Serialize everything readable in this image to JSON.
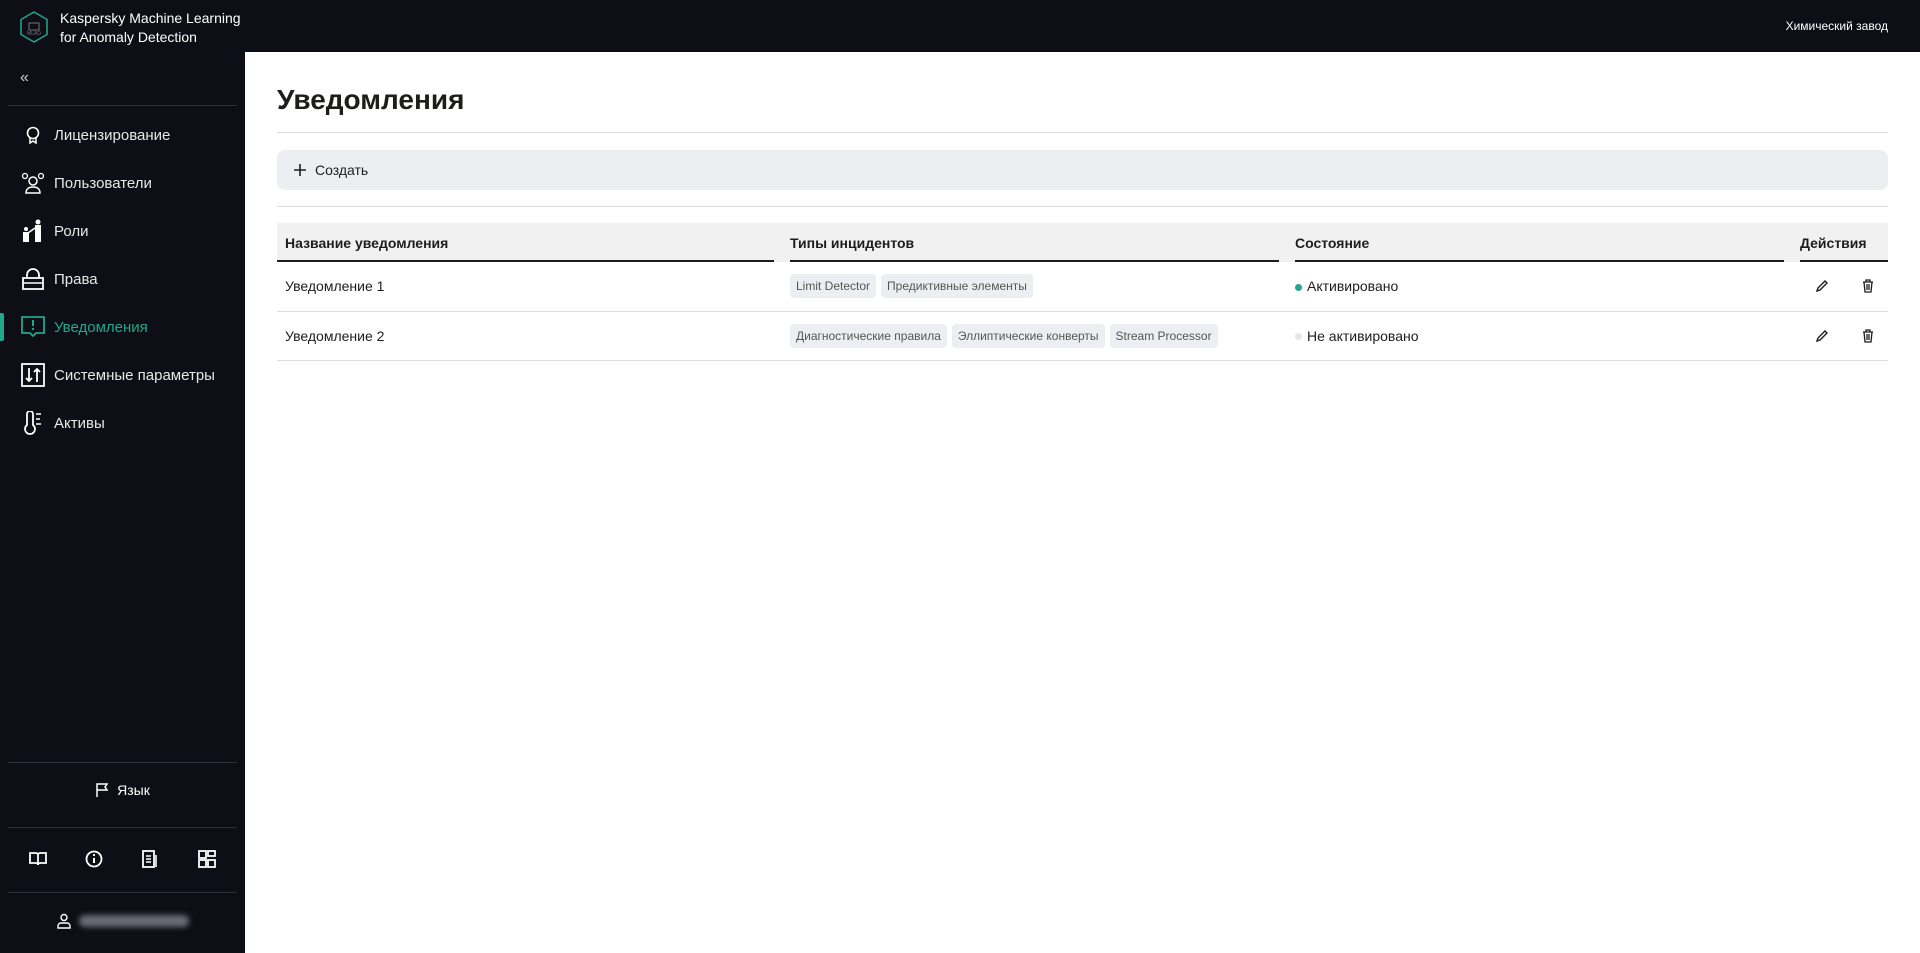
{
  "header": {
    "app_title_line1": "Kaspersky Machine Learning",
    "app_title_line2": "for Anomaly Detection",
    "organization": "Химический завод"
  },
  "sidebar": {
    "items": [
      {
        "label": "Лицензирование",
        "icon": "license-icon"
      },
      {
        "label": "Пользователи",
        "icon": "users-icon"
      },
      {
        "label": "Роли",
        "icon": "roles-icon"
      },
      {
        "label": "Права",
        "icon": "lock-icon"
      },
      {
        "label": "Уведомления",
        "icon": "notification-icon",
        "active": true
      },
      {
        "label": "Системные параметры",
        "icon": "settings-icon"
      },
      {
        "label": "Активы",
        "icon": "thermometer-icon"
      }
    ],
    "language_label": "Язык"
  },
  "main": {
    "title": "Уведомления",
    "create_label": "Создать",
    "table": {
      "headers": [
        "Название уведомления",
        "Типы инцидентов",
        "Состояние",
        "Действия"
      ],
      "rows": [
        {
          "name": "Уведомление 1",
          "types": [
            "Limit Detector",
            "Предиктивные элементы"
          ],
          "state": "Активировано",
          "active": true
        },
        {
          "name": "Уведомление 2",
          "types": [
            "Диагностические правила",
            "Эллиптические конверты",
            "Stream Processor"
          ],
          "state": "Не активировано",
          "active": false
        }
      ]
    }
  },
  "colors": {
    "accent": "#1fa88a",
    "sidebar_bg": "#0d0e16",
    "inactive_dot": "#e6e6e6"
  }
}
